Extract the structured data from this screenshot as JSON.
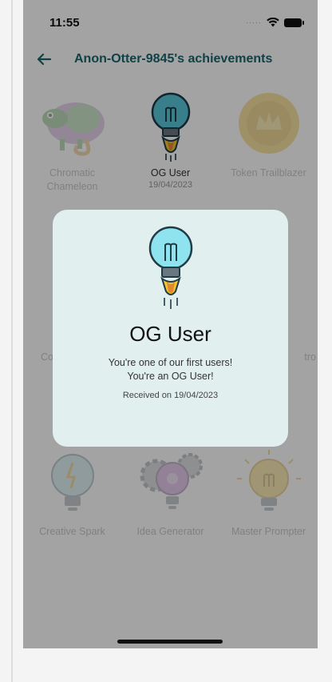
{
  "status_bar": {
    "time": "11:55",
    "signal": "·····"
  },
  "header": {
    "title": "Anon-Otter-9845's achievements"
  },
  "achievements": [
    {
      "name": "Chromatic Chameleon",
      "date": "",
      "icon": "chameleon-icon"
    },
    {
      "name": "OG User",
      "date": "19/04/2023",
      "icon": "rocket-bulb-icon"
    },
    {
      "name": "Token Trailblazer",
      "date": "",
      "icon": "crown-coin-icon"
    },
    {
      "name": "Co",
      "date": "",
      "icon": "badge-icon"
    },
    {
      "name": "tro",
      "date": "",
      "icon": "badge-icon"
    },
    {
      "name": "Creative Spark",
      "date": "",
      "icon": "spark-bulb-icon"
    },
    {
      "name": "Idea Generator",
      "date": "",
      "icon": "gear-bulb-icon"
    },
    {
      "name": "Master Prompter",
      "date": "",
      "icon": "glow-bulb-icon"
    }
  ],
  "modal": {
    "title": "OG User",
    "description": "You're one of our first users! You're an OG User!",
    "received": "Received on 19/04/2023",
    "icon": "rocket-bulb-icon"
  },
  "colors": {
    "accent": "#19676f",
    "modal_bg": "#e1efef",
    "overlay": "#5c5c5c"
  }
}
